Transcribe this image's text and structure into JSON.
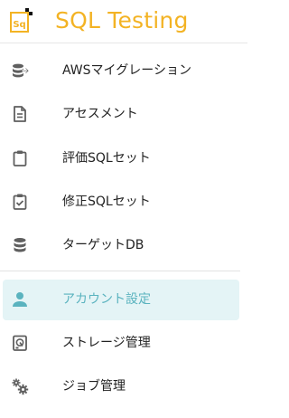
{
  "app": {
    "title": "SQL Testing",
    "logo_text": "Sq",
    "brand_color": "#f3b324"
  },
  "nav": {
    "items": [
      {
        "label": "AWSマイグレーション",
        "icon": "database-migration-icon"
      },
      {
        "label": "アセスメント",
        "icon": "document-icon"
      },
      {
        "label": "評価SQLセット",
        "icon": "clipboard-icon"
      },
      {
        "label": "修正SQLセット",
        "icon": "clipboard-check-icon"
      },
      {
        "label": "ターゲットDB",
        "icon": "database-icon"
      },
      {
        "label": "アカウント設定",
        "icon": "person-icon",
        "active": true
      },
      {
        "label": "ストレージ管理",
        "icon": "storage-icon"
      },
      {
        "label": "ジョブ管理",
        "icon": "gears-icon"
      }
    ]
  },
  "colors": {
    "active_bg": "#e4f4f6",
    "active_text": "#5ab3bf",
    "icon_gray": "#5f5f5f"
  }
}
